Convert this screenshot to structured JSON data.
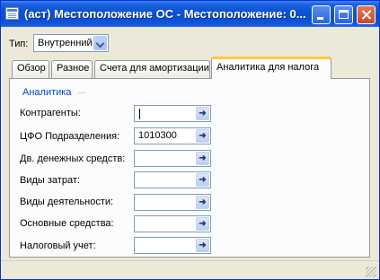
{
  "window": {
    "title": "(аст) Местоположение ОС - Местоположение: 0...",
    "minimize_label": "",
    "maximize_label": "",
    "close_label": ""
  },
  "type_field": {
    "label": "Тип:",
    "value": "Внутренний"
  },
  "tabs": [
    {
      "label": "Обзор",
      "active": false
    },
    {
      "label": "Разное",
      "active": false
    },
    {
      "label": "Счета для амортизации",
      "active": false
    },
    {
      "label": "Аналитика для налога",
      "active": true
    }
  ],
  "group": {
    "title": "Аналитика",
    "fields": [
      {
        "label": "Контрагенты:",
        "value": ""
      },
      {
        "label": "ЦФО Подразделения:",
        "value": "1010300"
      },
      {
        "label": "Дв. денежных средств:",
        "value": ""
      },
      {
        "label": "Виды затрат:",
        "value": ""
      },
      {
        "label": "Виды деятельности:",
        "value": ""
      },
      {
        "label": "Основные средства:",
        "value": ""
      },
      {
        "label": "Налоговый учет:",
        "value": ""
      }
    ],
    "lookup_glyph": "➜"
  },
  "colors": {
    "titlebar": "#0a53d6",
    "active_tab_accent": "#ffc83c",
    "group_title": "#0046d5"
  }
}
